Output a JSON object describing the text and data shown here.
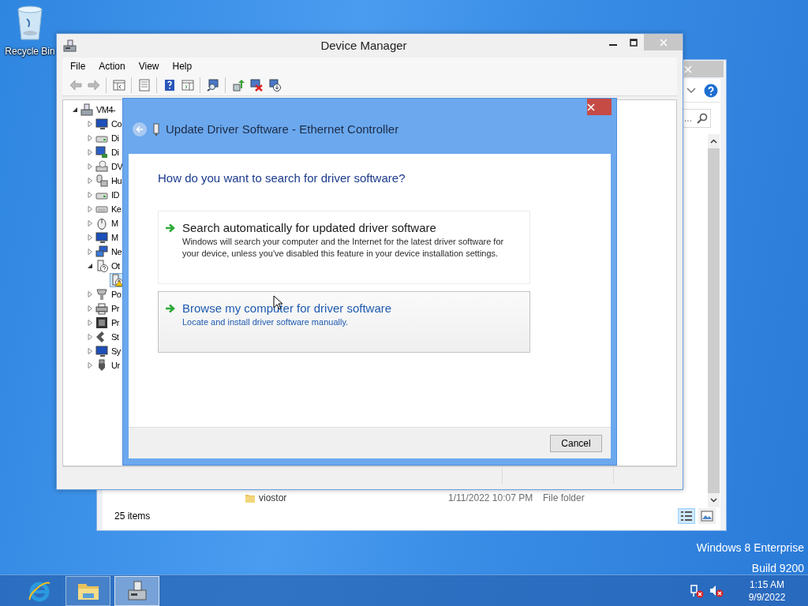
{
  "desktop": {
    "icons": [
      {
        "label": "Recycle Bin"
      }
    ],
    "edition": [
      "Windows 8 Enterprise",
      "Build 9200"
    ]
  },
  "explorer": {
    "search": {
      "placeholder": "..."
    },
    "files": [
      {
        "name": "viostor",
        "date_modified": "1/11/2022 10:07 PM",
        "type": "File folder"
      }
    ],
    "status": "25 items",
    "views": [
      {
        "kind": "details",
        "selected": true
      },
      {
        "kind": "large-icons",
        "selected": false
      }
    ]
  },
  "device_manager": {
    "title": "Device Manager",
    "menu": [
      "File",
      "Action",
      "View",
      "Help"
    ],
    "toolbar": [
      {
        "kind": "back",
        "disabled": true
      },
      {
        "kind": "forward",
        "disabled": true
      },
      {
        "kind": "sep"
      },
      {
        "kind": "console-tree",
        "disabled": false
      },
      {
        "kind": "sep"
      },
      {
        "kind": "properties",
        "disabled": false
      },
      {
        "kind": "sep"
      },
      {
        "kind": "help",
        "disabled": false
      },
      {
        "kind": "action-pane",
        "disabled": false
      },
      {
        "kind": "sep"
      },
      {
        "kind": "scan",
        "disabled": false
      },
      {
        "kind": "sep"
      },
      {
        "kind": "update",
        "disabled": false
      },
      {
        "kind": "uninstall",
        "disabled": false
      },
      {
        "kind": "enable",
        "disabled": false
      }
    ],
    "tree": [
      {
        "label": "VM4-",
        "kind": "computer",
        "expanded": true,
        "selected": false,
        "children": [
          {
            "label": "Co",
            "kind": "monitor",
            "expanded": false,
            "selected": false
          },
          {
            "label": "Di",
            "kind": "disk",
            "expanded": false,
            "selected": false
          },
          {
            "label": "Di",
            "kind": "display",
            "expanded": false,
            "selected": false
          },
          {
            "label": "DV",
            "kind": "dvd",
            "expanded": false,
            "selected": false
          },
          {
            "label": "Hu",
            "kind": "hid",
            "expanded": false,
            "selected": false
          },
          {
            "label": "ID",
            "kind": "disk",
            "expanded": false,
            "selected": false
          },
          {
            "label": "Ke",
            "kind": "keyboard",
            "expanded": false,
            "selected": false
          },
          {
            "label": "M",
            "kind": "mouse",
            "expanded": false,
            "selected": false
          },
          {
            "label": "M",
            "kind": "monitor",
            "expanded": false,
            "selected": false
          },
          {
            "label": "Ne",
            "kind": "network",
            "expanded": false,
            "selected": false
          },
          {
            "label": "Ot",
            "kind": "unknown",
            "expanded": true,
            "selected": false,
            "children": [
              {
                "kind": "unknown",
                "warning": true,
                "selected": true
              }
            ]
          },
          {
            "label": "Po",
            "kind": "port",
            "expanded": false,
            "selected": false
          },
          {
            "label": "Pr",
            "kind": "printer",
            "expanded": false,
            "selected": false
          },
          {
            "label": "Pr",
            "kind": "chip",
            "expanded": false,
            "selected": false
          },
          {
            "label": "St",
            "kind": "storage",
            "expanded": false,
            "selected": false
          },
          {
            "label": "Sy",
            "kind": "monitor",
            "expanded": false,
            "selected": false
          },
          {
            "label": "Ur",
            "kind": "usb",
            "expanded": false,
            "selected": false
          }
        ]
      }
    ]
  },
  "dialog": {
    "back": {
      "disabled": true
    },
    "title": "Update Driver Software - Ethernet Controller",
    "heading": "How do you want to search for driver software?",
    "options": [
      {
        "title": "Search automatically for updated driver software",
        "description": "Windows will search your computer and the Internet for the latest driver software for your device, unless you've disabled this feature in your device installation settings.",
        "hovered": false
      },
      {
        "title": "Browse my computer for driver software",
        "description": "Locate and install driver software manually.",
        "hovered": true
      }
    ],
    "buttons": [
      "Cancel"
    ]
  },
  "taskbar": {
    "apps": [
      {
        "kind": "ie",
        "running": false,
        "selected": false
      },
      {
        "kind": "explorer",
        "running": true,
        "selected": false
      },
      {
        "kind": "device-manager",
        "running": true,
        "selected": true
      }
    ],
    "clock": {
      "time": "1:15 AM",
      "date": "9/9/2022"
    }
  }
}
